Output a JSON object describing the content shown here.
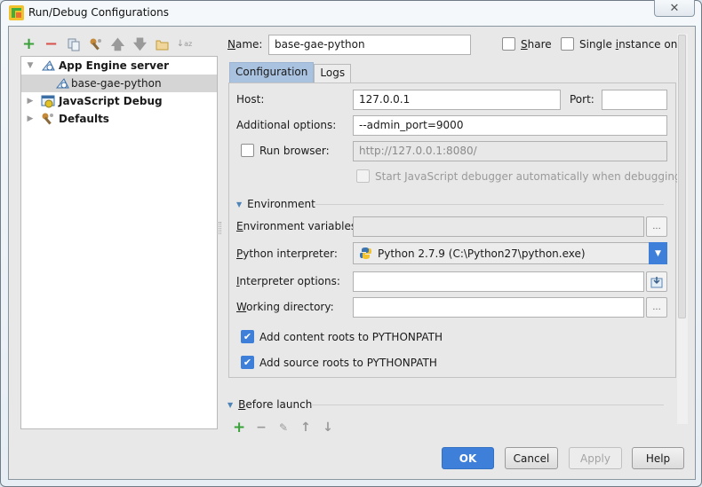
{
  "window": {
    "title": "Run/Debug Configurations",
    "close_label": "✕"
  },
  "toolbar": {
    "icons": [
      "add-icon",
      "remove-icon",
      "copy-icon",
      "edit-defaults-icon",
      "move-up-icon",
      "move-down-icon",
      "folder-icon",
      "sort-icon"
    ]
  },
  "tree": {
    "items": [
      {
        "label": "App Engine server",
        "expanded": true,
        "bold": true,
        "icon": "app-engine-icon"
      },
      {
        "label": "base-gae-python",
        "selected": true,
        "icon": "app-engine-icon"
      },
      {
        "label": "JavaScript Debug",
        "expanded": false,
        "bold": true,
        "icon": "javascript-debug-icon"
      },
      {
        "label": "Defaults",
        "expanded": false,
        "bold": true,
        "icon": "defaults-wrench-icon"
      }
    ]
  },
  "header": {
    "name_label_prefix": "N",
    "name_label_rest": "ame:",
    "name_value": "base-gae-python",
    "share_label_prefix": "S",
    "share_label_rest": "hare",
    "share_checked": false,
    "single_label_a": "Single ",
    "single_label_u": "i",
    "single_label_b": "nstance only",
    "single_checked": false
  },
  "tabs": [
    {
      "label": "Configuration",
      "active": true
    },
    {
      "label": "Logs",
      "active": false
    }
  ],
  "config": {
    "host_label": "Host:",
    "host_value": "127.0.0.1",
    "port_label": "Port:",
    "port_value": "",
    "additional_label": "Additional options:",
    "additional_value": "--admin_port=9000",
    "run_browser_label": "Run browser:",
    "run_browser_checked": false,
    "browser_url": "http://127.0.0.1:8080/",
    "js_debugger_label": "Start JavaScript debugger automatically when debugging",
    "js_debugger_checked": false,
    "environment_header": "Environment",
    "env_vars_label_u": "E",
    "env_vars_label_rest": "nvironment variables:",
    "env_vars_value": "",
    "interpreter_label_u": "P",
    "interpreter_label_rest": "ython interpreter:",
    "interpreter_value": "Python 2.7.9 (C:\\Python27\\python.exe)",
    "interp_options_label_u": "I",
    "interp_options_label_rest": "nterpreter options:",
    "interp_options_value": "",
    "working_dir_label_u": "W",
    "working_dir_label_rest": "orking directory:",
    "working_dir_value": "",
    "content_roots_label": "Add content roots to PYTHONPATH",
    "content_roots_checked": true,
    "source_roots_label": "Add source roots to PYTHONPATH",
    "source_roots_checked": true,
    "browse_label": "...",
    "check_mark": "✔"
  },
  "before_launch": {
    "header_u": "B",
    "header_rest": "efore launch",
    "tools": [
      "+",
      "−",
      "✎",
      "↑",
      "↓"
    ]
  },
  "buttons": {
    "ok": "OK",
    "cancel": "Cancel",
    "apply": "Apply",
    "help": "Help"
  },
  "colors": {
    "accent": "#3d7fd9",
    "add_green": "#3aa03a",
    "remove_red": "#d9534f"
  }
}
